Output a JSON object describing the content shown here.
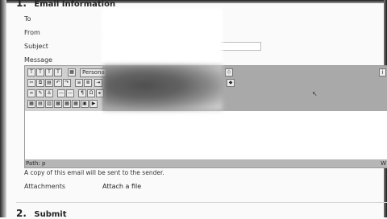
{
  "form": {
    "section1": {
      "number": "1.",
      "title": "Email Information"
    },
    "fields": {
      "to_label": "To",
      "from_label": "From",
      "subject_label": "Subject",
      "message_label": "Message"
    },
    "editor": {
      "style_dropdown": "Persona",
      "path_label": "Path: p",
      "right_status": "W",
      "toolbar_icons": [
        "bold-icon",
        "italic-icon",
        "underline-icon",
        "strikethrough-icon",
        "cut-icon",
        "copy-icon",
        "paste-icon",
        "undo-icon",
        "redo-icon",
        "link-icon",
        "unlink-icon",
        "table-icon",
        "image-icon"
      ]
    },
    "note": "A copy of this email will be sent to the sender.",
    "attachments_label": "Attachments",
    "attach_link": "Attach a file",
    "section2": {
      "number": "2.",
      "title": "Submit"
    }
  }
}
